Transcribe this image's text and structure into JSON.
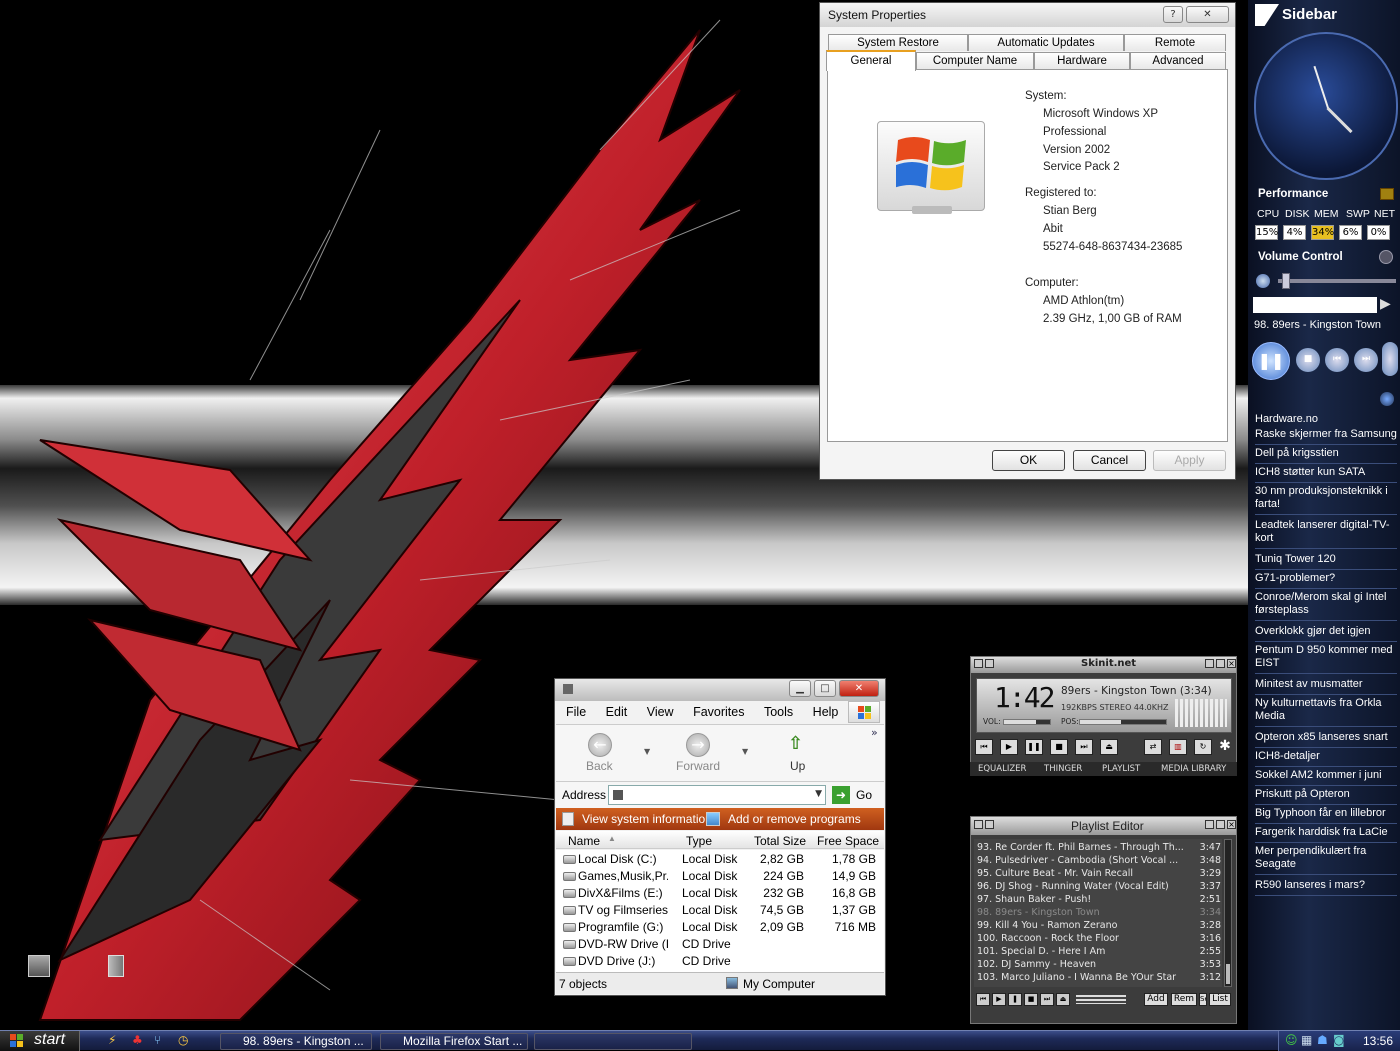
{
  "sysprops": {
    "title": "System Properties",
    "help": "?",
    "close": "✕",
    "tabs_row1": [
      "System Restore",
      "Automatic Updates",
      "Remote"
    ],
    "tabs_row2": [
      "General",
      "Computer Name",
      "Hardware",
      "Advanced"
    ],
    "system_label": "System:",
    "system_lines": [
      "Microsoft Windows XP",
      "Professional",
      "Version 2002",
      "Service Pack 2"
    ],
    "registered_label": "Registered to:",
    "registered_lines": [
      "Stian Berg",
      "Abit",
      "55274-648-8637434-23685"
    ],
    "computer_label": "Computer:",
    "computer_lines": [
      "AMD Athlon(tm)",
      "2.39 GHz, 1,00 GB of RAM"
    ],
    "ok": "OK",
    "cancel": "Cancel",
    "apply": "Apply"
  },
  "explorer": {
    "menu": [
      "File",
      "Edit",
      "View",
      "Favorites",
      "Tools",
      "Help"
    ],
    "back": "Back",
    "forward": "Forward",
    "up": "Up",
    "address_label": "Address",
    "go": "Go",
    "tasks": [
      "View system information",
      "Add or remove programs"
    ],
    "columns": [
      "Name",
      "Type",
      "Total Size",
      "Free Space"
    ],
    "rows": [
      {
        "name": "Local Disk (C:)",
        "type": "Local Disk",
        "total": "2,82 GB",
        "free": "1,78 GB"
      },
      {
        "name": "Games,Musik,Pr...",
        "type": "Local Disk",
        "total": "224 GB",
        "free": "14,9 GB"
      },
      {
        "name": "DivX&Films (E:)",
        "type": "Local Disk",
        "total": "232 GB",
        "free": "16,8 GB"
      },
      {
        "name": "TV og Filmseries ...",
        "type": "Local Disk",
        "total": "74,5 GB",
        "free": "1,37 GB"
      },
      {
        "name": "Programfile (G:)",
        "type": "Local Disk",
        "total": "2,09 GB",
        "free": "716 MB"
      },
      {
        "name": "DVD-RW Drive (I:)",
        "type": "CD Drive",
        "total": "",
        "free": ""
      },
      {
        "name": "DVD Drive (J:)",
        "type": "CD Drive",
        "total": "",
        "free": ""
      }
    ],
    "status_count": "7 objects",
    "status_location": "My Computer"
  },
  "winamp": {
    "brand": "Skinit.net",
    "time": "1:42",
    "track": "89ers - Kingston Town (3:34)",
    "bitrate": "192KBPS STEREO 44.0KHZ",
    "vol_label": "VOL:",
    "pos_label": "POS:",
    "tabs": [
      "EQUALIZER",
      "THINGER",
      "PLAYLIST",
      "MEDIA LIBRARY"
    ],
    "volume": 0.7,
    "position": 0.48
  },
  "playlist": {
    "title": "Playlist Editor",
    "items": [
      {
        "text": "93. Re Corder ft. Phil Barnes - Through Th...",
        "dur": "3:47"
      },
      {
        "text": "94. Pulsedriver - Cambodia (Short Vocal ...",
        "dur": "3:48"
      },
      {
        "text": "95. Culture Beat - Mr. Vain  Recall",
        "dur": "3:29"
      },
      {
        "text": "96. DJ Shog - Running Water (Vocal Edit)",
        "dur": "3:37"
      },
      {
        "text": "97. Shaun Baker - Push!",
        "dur": "2:51"
      },
      {
        "text": "98. 89ers - Kingston Town",
        "dur": "3:34"
      },
      {
        "text": "99. Kill 4 You - Ramon Zerano",
        "dur": "3:28"
      },
      {
        "text": "100. Raccoon - Rock the Floor",
        "dur": "3:16"
      },
      {
        "text": "101. Special D. - Here I Am",
        "dur": "2:55"
      },
      {
        "text": "102. DJ Sammy - Heaven",
        "dur": "3:53"
      },
      {
        "text": "103. Marco Juliano - I Wanna Be YOur Star",
        "dur": "3:12"
      }
    ],
    "current_index": 5,
    "buttons": [
      "Add",
      "Rem",
      "Sel",
      "List"
    ]
  },
  "sidebar": {
    "title": "Sidebar",
    "performance": "Performance",
    "perf_labels": [
      "CPU",
      "DISK",
      "MEM",
      "SWP",
      "NET"
    ],
    "perf_values": [
      "15%",
      "4%",
      "34%",
      "6%",
      "0%"
    ],
    "volume_title": "Volume Control",
    "now_playing": "98. 89ers - Kingston Town",
    "news_source": "Hardware.no",
    "news": [
      "Raske skjermer fra Samsung",
      "Dell på krigsstien",
      "ICH8 støtter kun SATA",
      "30 nm produksjonsteknikk i farta!",
      "Leadtek lanserer digital-TV-kort",
      "Tuniq Tower 120",
      "G71-problemer?",
      "Conroe/Merom skal gi Intel førsteplass",
      "Overklokk gjør det igjen",
      "Pentum D 950 kommer med EIST",
      "Minitest av musmatter",
      "Ny kulturnettavis fra Orkla Media",
      "Opteron x85 lanseres snart",
      "ICH8-detaljer",
      "Sokkel AM2 kommer i juni",
      "Priskutt på Opteron",
      "Big Typhoon får en lillebror",
      "Fargerik harddisk fra LaCie",
      "Mer perpendikulært fra Seagate",
      "R590 lanseres i mars?"
    ]
  },
  "taskbar": {
    "start": "start",
    "tasks": [
      "98. 89ers - Kingston ...",
      "Mozilla Firefox Start ..."
    ],
    "clock": "13:56"
  }
}
